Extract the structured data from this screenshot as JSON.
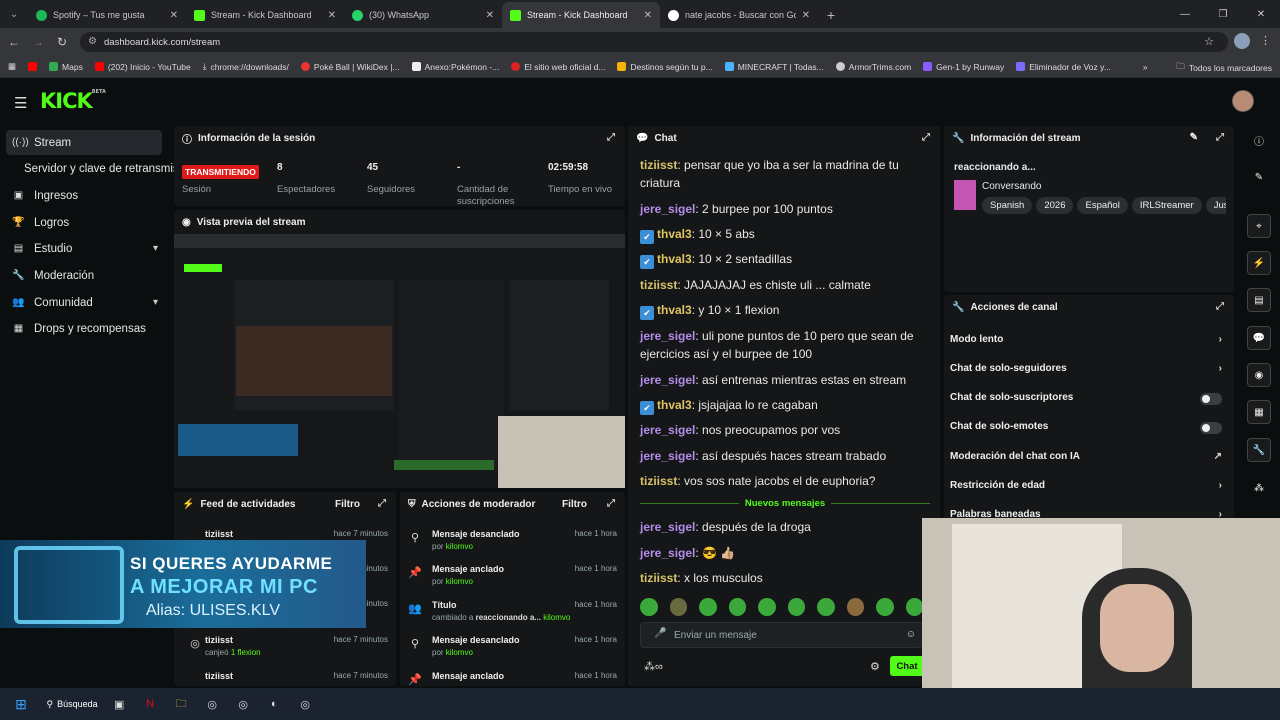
{
  "browser": {
    "tabs": [
      {
        "title": "Spotify – Tus me gusta",
        "color": "#1db954",
        "active": false
      },
      {
        "title": "Stream - Kick Dashboard",
        "color": "#53fc18",
        "active": false
      },
      {
        "title": "(30) WhatsApp",
        "color": "#25d366",
        "active": false
      },
      {
        "title": "Stream - Kick Dashboard",
        "color": "#53fc18",
        "active": true
      },
      {
        "title": "nate jacobs - Buscar con Google",
        "color": "#4285f4",
        "active": false
      }
    ],
    "url": "dashboard.kick.com/stream",
    "bookmarks": [
      "Maps",
      "(202) Inicio - YouTube",
      "chrome://downloads/",
      "Poké Ball | WikiDex |...",
      "Anexo:Pokémon -...",
      "El sitio web oficial d...",
      "Destinos según tu p...",
      "MINECRAFT | Todas...",
      "ArmorTrims.com",
      "Gen-1 by Runway",
      "Eliminador de Voz y..."
    ],
    "bookmarks_all": "Todos los marcadores"
  },
  "app": {
    "logo": "KICK",
    "logo_sup": "BETA"
  },
  "sidebar": {
    "items": [
      {
        "label": "Stream",
        "icon": "broadcast-icon"
      },
      {
        "label": "Servidor y clave de retransmisión",
        "icon": ""
      },
      {
        "label": "Ingresos",
        "icon": "dollar-icon"
      },
      {
        "label": "Logros",
        "icon": "trophy-icon"
      },
      {
        "label": "Estudio",
        "icon": "studio-icon"
      },
      {
        "label": "Moderación",
        "icon": "wrench-icon"
      },
      {
        "label": "Comunidad",
        "icon": "users-icon"
      },
      {
        "label": "Drops y recompensas",
        "icon": "gift-icon"
      }
    ]
  },
  "session": {
    "title": "Información de la sesión",
    "live": "TRANSMITIENDO",
    "live_label": "Sesión",
    "stats": [
      {
        "value": "8",
        "label": "Espectadores"
      },
      {
        "value": "45",
        "label": "Seguidores"
      },
      {
        "value": "-",
        "label": "Cantidad de suscripciones"
      },
      {
        "value": "02:59:58",
        "label": "Tiempo en vivo"
      }
    ]
  },
  "preview": {
    "title": "Vista previa del stream"
  },
  "feed": {
    "title": "Feed de actividades",
    "filter": "Filtro",
    "items": [
      {
        "user": "tiziisst",
        "time": "hace 7 minutos",
        "sub": "",
        "amount": ""
      },
      {
        "user": "tiziisst",
        "time": "hace 7 minutos",
        "sub": "",
        "amount": ""
      },
      {
        "user": "tiziisst",
        "time": "hace 7 minutos",
        "sub": "",
        "amount": ""
      },
      {
        "user": "tiziisst",
        "time": "hace 7 minutos",
        "sub": "canjeó",
        "amount": "1 flexion"
      },
      {
        "user": "tiziisst",
        "time": "hace 7 minutos",
        "sub": "",
        "amount": ""
      }
    ]
  },
  "modactions": {
    "title": "Acciones de moderador",
    "filter": "Filtro",
    "items": [
      {
        "action": "Mensaje desanclado",
        "by": "por",
        "user": "kilomvo",
        "time": "hace 1 hora",
        "icon": "unpin-icon",
        "detail": ""
      },
      {
        "action": "Mensaje anclado",
        "by": "por",
        "user": "kilomvo",
        "time": "hace 1 hora",
        "icon": "pin-icon",
        "detail": ""
      },
      {
        "action": "Título",
        "by": "cambiado a",
        "user": "kilomvo",
        "time": "hace 1 hora",
        "icon": "users-icon",
        "detail": "reaccionando a..."
      },
      {
        "action": "Mensaje desanclado",
        "by": "por",
        "user": "kilomvo",
        "time": "hace 1 hora",
        "icon": "unpin-icon",
        "detail": ""
      },
      {
        "action": "Mensaje anclado",
        "by": "",
        "user": "",
        "time": "hace 1 hora",
        "icon": "pin-icon",
        "detail": ""
      }
    ]
  },
  "chat": {
    "title": "Chat",
    "messages": [
      {
        "user": "tiziisst",
        "text": "pensar que yo iba a ser la madrina de tu criatura",
        "badge": false,
        "color": "t"
      },
      {
        "user": "jere_sigel",
        "text": "2 burpee por 100 puntos",
        "badge": false,
        "color": "j"
      },
      {
        "user": "thval3",
        "text": "10 × 5 abs",
        "badge": true,
        "color": "v"
      },
      {
        "user": "thval3",
        "text": "10 × 2 sentadillas",
        "badge": true,
        "color": "v"
      },
      {
        "user": "tiziisst",
        "text": "JAJAJAJAJ es chiste uli ... calmate",
        "badge": false,
        "color": "t"
      },
      {
        "user": "thval3",
        "text": "y 10 × 1 flexion",
        "badge": true,
        "color": "v"
      },
      {
        "user": "jere_sigel",
        "text": "uli pone puntos de 10 pero que sean de ejercicios así y el burpee de 100",
        "badge": false,
        "color": "j"
      },
      {
        "user": "jere_sigel",
        "text": "así entrenas mientras estas en stream",
        "badge": false,
        "color": "j"
      },
      {
        "user": "thval3",
        "text": "jsjajajaa lo re cagaban",
        "badge": true,
        "color": "v"
      },
      {
        "user": "jere_sigel",
        "text": "nos preocupamos por vos",
        "badge": false,
        "color": "j"
      },
      {
        "user": "jere_sigel",
        "text": "así después haces stream trabado",
        "badge": false,
        "color": "j"
      },
      {
        "user": "tiziisst",
        "text": "vos sos nate jacobs el de euphoria?",
        "badge": false,
        "color": "t"
      }
    ],
    "new_label": "Nuevos mensajes",
    "new_messages": [
      {
        "user": "jere_sigel",
        "text": "después de la droga",
        "color": "j"
      },
      {
        "user": "jere_sigel",
        "text": "😎 👍🏼",
        "color": "j"
      },
      {
        "user": "tiziisst",
        "text": "x los musculos",
        "color": "t"
      }
    ],
    "placeholder": "Enviar un mensaje",
    "send": "Chat"
  },
  "streaminfo": {
    "title": "Información del stream",
    "stream_title": "reaccionando a...",
    "category": "Conversando",
    "tags": [
      "Spanish",
      "2026",
      "Español",
      "IRLStreamer",
      "JustC"
    ]
  },
  "channel_actions": {
    "title": "Acciones de canal",
    "items": [
      {
        "label": "Modo lento",
        "kind": "chevron"
      },
      {
        "label": "Chat de solo-seguidores",
        "kind": "chevron"
      },
      {
        "label": "Chat de solo-suscriptores",
        "kind": "toggle"
      },
      {
        "label": "Chat de solo-emotes",
        "kind": "toggle"
      },
      {
        "label": "Moderación del chat con IA",
        "kind": "external"
      },
      {
        "label": "Restricción de edad",
        "kind": "chevron"
      },
      {
        "label": "Palabras baneadas",
        "kind": "chevron"
      }
    ]
  },
  "overlay": {
    "line1": "SI QUERES AYUDARME",
    "line2": "A MEJORAR MI PC",
    "line3": "Alias: ULISES.KLV"
  },
  "taskbar": {
    "search": "Búsqueda"
  }
}
